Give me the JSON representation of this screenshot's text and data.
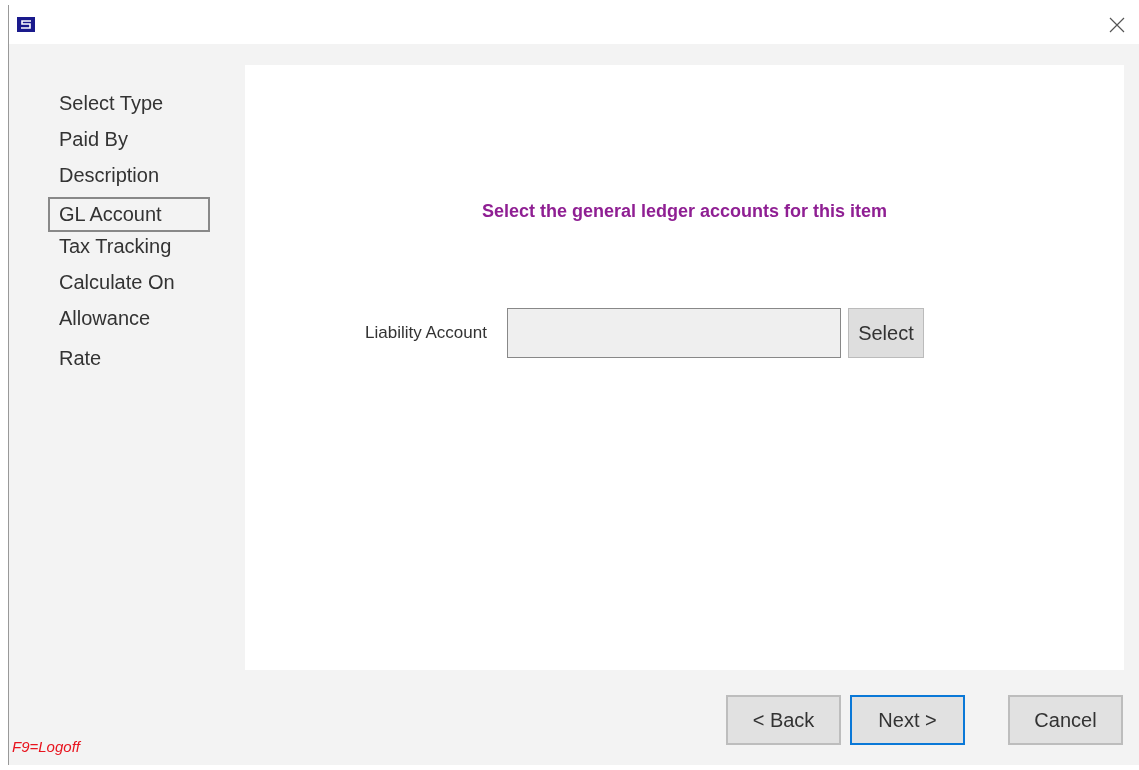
{
  "steps": [
    {
      "label": "Select Type",
      "selected": false
    },
    {
      "label": "Paid By",
      "selected": false
    },
    {
      "label": "Description",
      "selected": false
    },
    {
      "label": "GL Account",
      "selected": true
    },
    {
      "label": "Tax Tracking",
      "selected": false
    },
    {
      "label": "Calculate On",
      "selected": false
    },
    {
      "label": "Allowance",
      "selected": false
    },
    {
      "label": "Rate",
      "selected": false
    }
  ],
  "heading": "Select the general ledger accounts for this item",
  "field": {
    "label": "Liability Account",
    "button": "Select"
  },
  "buttons": [
    {
      "label": "< Back",
      "focused": false
    },
    {
      "label": "Next >",
      "focused": true
    },
    {
      "label": "Cancel",
      "focused": false
    }
  ],
  "status": "F9=Logoff"
}
